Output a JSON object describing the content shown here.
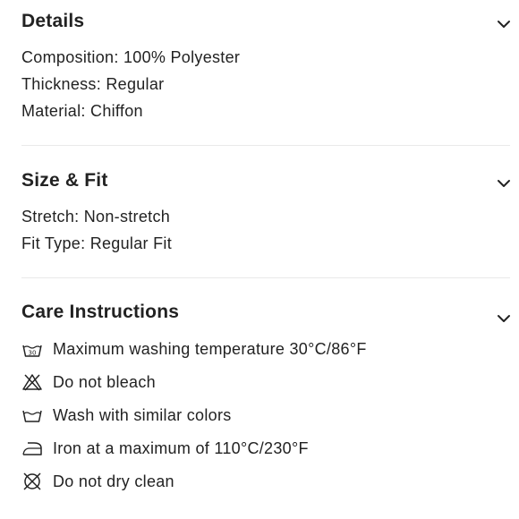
{
  "details": {
    "title": "Details",
    "lines": [
      "Composition: 100% Polyester",
      "Thickness: Regular",
      "Material: Chiffon"
    ]
  },
  "size_fit": {
    "title": "Size & Fit",
    "lines": [
      "Stretch: Non-stretch",
      "Fit Type: Regular Fit"
    ]
  },
  "care": {
    "title": "Care Instructions",
    "items": [
      {
        "icon": "wash-30-icon",
        "text": "Maximum washing temperature 30°C/86°F"
      },
      {
        "icon": "no-bleach-icon",
        "text": "Do not bleach"
      },
      {
        "icon": "wash-tub-icon",
        "text": "Wash with similar colors"
      },
      {
        "icon": "iron-icon",
        "text": "Iron at a maximum of 110°C/230°F"
      },
      {
        "icon": "no-dry-clean-icon",
        "text": "Do not dry clean"
      }
    ]
  }
}
